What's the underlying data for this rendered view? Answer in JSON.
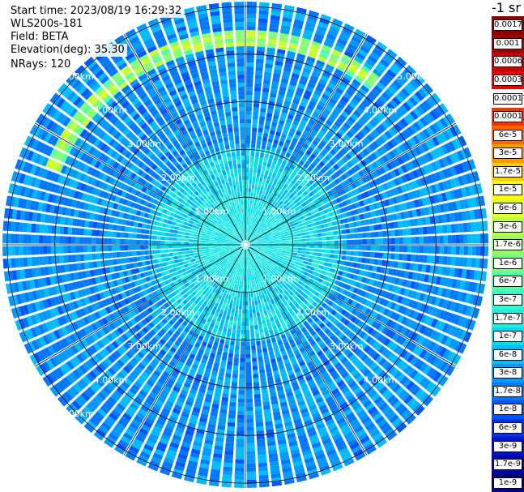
{
  "header": {
    "start_time": "Start time: 2023/08/19 16:29:32",
    "instrument": "WLS200s-181",
    "field": "Field: BETA",
    "elevation": "Elevation(deg): 35.30",
    "nrays": "NRays: 120"
  },
  "colorbar": {
    "units_label": "-1 sr",
    "segments": [
      {
        "label": "0.0017",
        "color": "#8b0000"
      },
      {
        "label": "0.001",
        "color": "#a00000"
      },
      {
        "label": "0.0006",
        "color": "#c80000"
      },
      {
        "label": "0.0003",
        "color": "#e60000"
      },
      {
        "label": "0.00017",
        "color": "#ffffff"
      },
      {
        "label": "0.0001",
        "color": "#ff3300"
      },
      {
        "label": "6e-5",
        "color": "#ff6600"
      },
      {
        "label": "3e-5",
        "color": "#ff9900"
      },
      {
        "label": "1.7e-5",
        "color": "#ffcc00"
      },
      {
        "label": "1e-5",
        "color": "#ffff00"
      },
      {
        "label": "6e-6",
        "color": "#ddff22"
      },
      {
        "label": "3e-6",
        "color": "#bbff44"
      },
      {
        "label": "1.7e-6",
        "color": "#99ff66"
      },
      {
        "label": "1e-6",
        "color": "#77ff88"
      },
      {
        "label": "6e-7",
        "color": "#55ffaa"
      },
      {
        "label": "3e-7",
        "color": "#33ffcc"
      },
      {
        "label": "1.7e-7",
        "color": "#22eedd"
      },
      {
        "label": "1e-7",
        "color": "#00ddee"
      },
      {
        "label": "6e-8",
        "color": "#00bbff"
      },
      {
        "label": "3e-8",
        "color": "#0099ff"
      },
      {
        "label": "1.7e-8",
        "color": "#0077ff"
      },
      {
        "label": "1e-8",
        "color": "#0055ff"
      },
      {
        "label": "6e-9",
        "color": "#0033ee"
      },
      {
        "label": "3e-9",
        "color": "#0011cc"
      },
      {
        "label": "1.7e-9",
        "color": "#0000aa"
      },
      {
        "label": "1e-9",
        "color": "#000080"
      }
    ]
  },
  "rings": [
    {
      "label": "1.00km"
    },
    {
      "label": "2.00km"
    },
    {
      "label": "3.00km"
    },
    {
      "label": "4.00km"
    },
    {
      "label": "5.00km"
    }
  ],
  "plot": {
    "n_rays": 120,
    "max_range_km": 5.1,
    "feature_band_range_km": [
      4.2,
      4.5
    ],
    "feature_band_azimuth_deg": [
      -70,
      40
    ]
  }
}
